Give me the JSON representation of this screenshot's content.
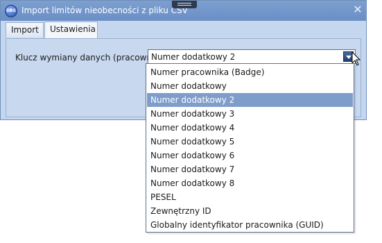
{
  "window": {
    "title": "Import limitów nieobecności z pliku CSV",
    "app_icon_text": "DBS",
    "close_glyph": "✕"
  },
  "tabs": [
    {
      "label": "Import",
      "active": false
    },
    {
      "label": "Ustawienia",
      "active": true
    }
  ],
  "settings": {
    "field_label": "Klucz wymiany danych (pracownik):",
    "selected_value": "Numer dodatkowy 2"
  },
  "dropdown": {
    "options": [
      "Numer pracownika (Badge)",
      "Numer dodatkowy",
      "Numer dodatkowy 2",
      "Numer dodatkowy 3",
      "Numer dodatkowy 4",
      "Numer dodatkowy 5",
      "Numer dodatkowy 6",
      "Numer dodatkowy 7",
      "Numer dodatkowy 8",
      "PESEL",
      "Zewnętrzny ID",
      "Globalny identyfikator pracownika (GUID)"
    ],
    "highlighted_index": 2
  },
  "colors": {
    "titlebar": "#6a8fc6",
    "panel": "#c7d8ef",
    "highlight": "#7f9dca"
  }
}
